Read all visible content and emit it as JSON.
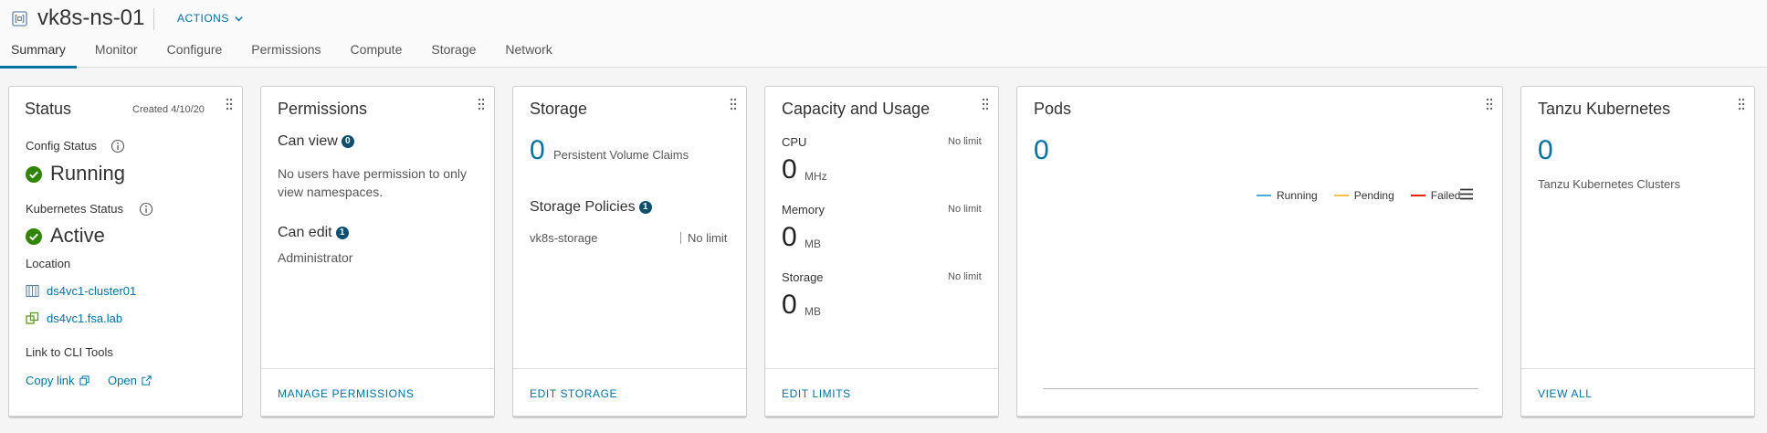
{
  "header": {
    "title": "vk8s-ns-01",
    "actions_label": "ACTIONS",
    "tabs": [
      {
        "label": "Summary",
        "active": true
      },
      {
        "label": "Monitor"
      },
      {
        "label": "Configure"
      },
      {
        "label": "Permissions"
      },
      {
        "label": "Compute"
      },
      {
        "label": "Storage"
      },
      {
        "label": "Network"
      }
    ]
  },
  "status_card": {
    "title": "Status",
    "created": "Created 4/10/20",
    "config_status_label": "Config Status",
    "config_status_value": "Running",
    "k8s_status_label": "Kubernetes Status",
    "k8s_status_value": "Active",
    "location_label": "Location",
    "cluster_link": "ds4vc1-cluster01",
    "vcenter_link": "ds4vc1.fsa.lab",
    "cli_label": "Link to CLI Tools",
    "copy_link": "Copy link",
    "open_link": "Open",
    "status_color": "#2f8400"
  },
  "permissions_card": {
    "title": "Permissions",
    "can_view_label": "Can view",
    "can_view_count": "0",
    "can_view_text": "No users have permission to only view namespaces.",
    "can_edit_label": "Can edit",
    "can_edit_count": "1",
    "can_edit_user": "Administrator",
    "footer": "MANAGE PERMISSIONS"
  },
  "storage_card": {
    "title": "Storage",
    "pvc_count": "0",
    "pvc_label": "Persistent Volume Claims",
    "policies_label": "Storage Policies",
    "policies_count": "1",
    "policy_name": "vk8s-storage",
    "policy_limit": "No limit",
    "footer": "EDIT STORAGE"
  },
  "capacity_card": {
    "title": "Capacity and Usage",
    "cpu_label": "CPU",
    "cpu_limit": "No limit",
    "cpu_value": "0",
    "cpu_unit": "MHz",
    "memory_label": "Memory",
    "memory_limit": "No limit",
    "memory_value": "0",
    "memory_unit": "MB",
    "storage_label": "Storage",
    "storage_limit": "No limit",
    "storage_value": "0",
    "storage_unit": "MB",
    "footer": "EDIT LIMITS"
  },
  "pods_card": {
    "title": "Pods",
    "count": "0",
    "legend": [
      {
        "label": "Running",
        "color": "#49afd9"
      },
      {
        "label": "Pending",
        "color": "#f6c244"
      },
      {
        "label": "Failed",
        "color": "#e62700"
      }
    ]
  },
  "tanzu_card": {
    "title": "Tanzu Kubernetes",
    "count": "0",
    "clusters_label": "Tanzu Kubernetes Clusters",
    "footer": "VIEW ALL"
  },
  "colors": {
    "accent": "#0072a3",
    "badge": "#0d4f6e"
  }
}
